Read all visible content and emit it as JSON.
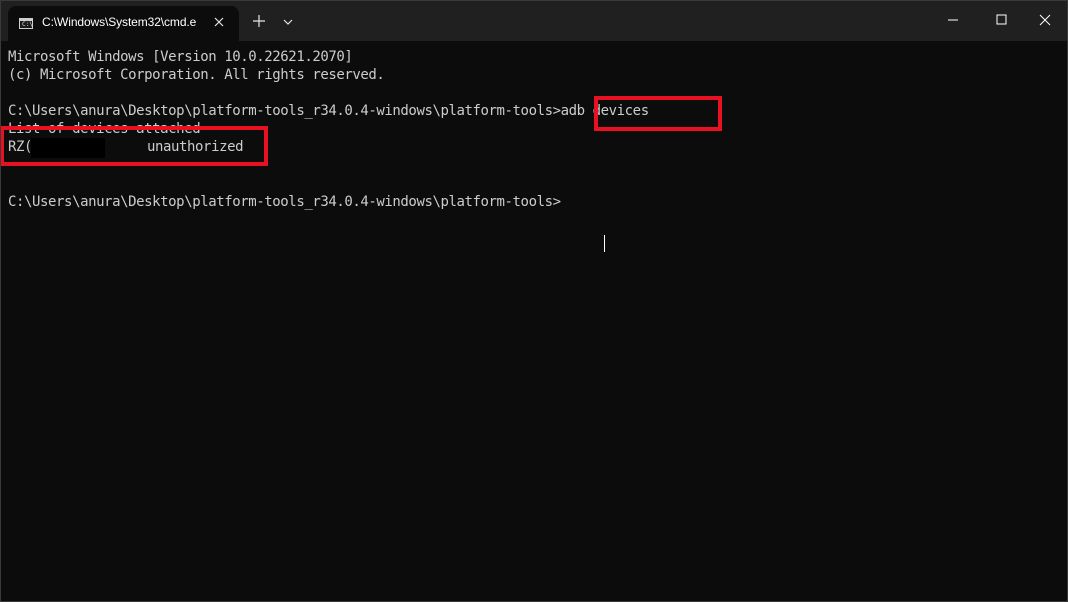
{
  "window": {
    "tab_title": "C:\\Windows\\System32\\cmd.e",
    "tab_icon": "cmd-icon",
    "accent_highlight": "#e81123",
    "background": "#0c0c0c"
  },
  "terminal": {
    "lines": [
      "Microsoft Windows [Version 10.0.22621.2070]",
      "(c) Microsoft Corporation. All rights reserved.",
      "C:\\Users\\anura\\Desktop\\platform-tools_r34.0.4-windows\\platform-tools>adb devices",
      "List of devices attached",
      "RZ(",
      "C:\\Users\\anura\\Desktop\\platform-tools_r34.0.4-windows\\platform-tools>"
    ],
    "device_status": "unauthorized"
  }
}
